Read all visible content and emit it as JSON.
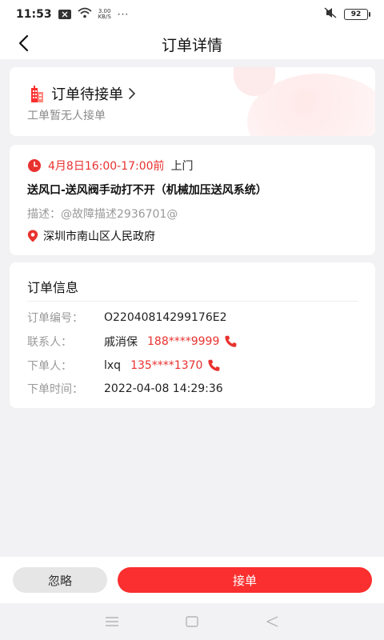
{
  "status_bar": {
    "time": "11:53",
    "speed_top": "3.00",
    "speed_bottom": "KB/S",
    "dots": "···",
    "battery": "92"
  },
  "header": {
    "title": "订单详情"
  },
  "order_status": {
    "title": "订单待接单",
    "subtitle": "工单暂无人接单"
  },
  "service": {
    "time": "4月8日16:00-17:00前",
    "visit": "上门",
    "fault_title": "送风口-送风阀手动打不开（机械加压送风系统）",
    "description": "描述：@故障描述2936701@",
    "address": "深圳市南山区人民政府"
  },
  "order_info": {
    "heading": "订单信息",
    "number_label": "订单编号：",
    "number_value": "O22040814299176E2",
    "contact_label": "联系人：",
    "contact_name": "戚消保",
    "contact_phone": "188****9999",
    "orderer_label": "下单人：",
    "orderer_name": "lxq",
    "orderer_phone": "135****1370",
    "time_label": "下单时间：",
    "time_value": "2022-04-08 14:29:36"
  },
  "actions": {
    "ignore": "忽略",
    "accept": "接单"
  },
  "colors": {
    "accent": "#fb2f2f",
    "highlight_text": "#e8322f"
  }
}
